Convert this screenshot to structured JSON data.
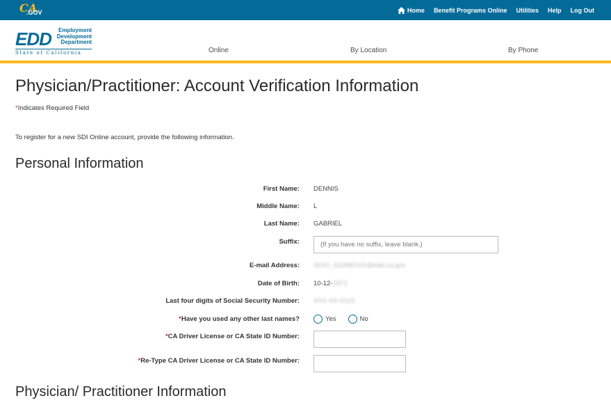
{
  "header": {
    "ca_logo_text": "CA",
    "ca_logo_gov": ".GOV",
    "top_nav": [
      "Home",
      "Benefit Programs Online",
      "Utilities",
      "Help",
      "Log Out"
    ],
    "edd_logo": {
      "letters": "EDD",
      "line1": "Employment",
      "line2": "Development",
      "line3": "Department",
      "state": "State of California"
    },
    "main_nav": [
      "Online",
      "By Location",
      "By Phone"
    ]
  },
  "page": {
    "title": "Physician/Practitioner: Account Verification Information",
    "required_marker": "*",
    "required_note": "Indicates Required Field",
    "intro": "To register for a new SDI Online account, provide the following information."
  },
  "personal": {
    "section_title": "Personal Information",
    "first_name_label": "First Name:",
    "first_name_value": "DENNIS",
    "middle_name_label": "Middle Name:",
    "middle_name_value": "L",
    "last_name_label": "Last Name:",
    "last_name_value": "GABRIEL",
    "suffix_label": "Suffix:",
    "suffix_placeholder": "(If you have no suffix, leave blank.)",
    "email_label": "E-mail Address:",
    "email_value": "SDIO_GDAB0101@edd.ca.gov",
    "dob_label": "Date of Birth:",
    "dob_value_visible": "10-12-",
    "dob_value_blurred": "1972",
    "ssn_label": "Last four digits of Social Security Number:",
    "ssn_value": "XXX-XX-0123",
    "other_names_label": "Have you used any other last names?",
    "other_names_options": [
      "Yes",
      "No"
    ],
    "dl_label": "CA Driver License or CA State ID Number:",
    "dl_value": "",
    "dl_retype_label": "Re-Type CA Driver License or CA State ID Number:",
    "dl_retype_value": ""
  },
  "practitioner": {
    "section_title": "Physician/ Practitioner Information"
  },
  "colors": {
    "top_bar": "#046b99",
    "accent_gold": "#fdb81e",
    "required_red": "#c0392b"
  }
}
